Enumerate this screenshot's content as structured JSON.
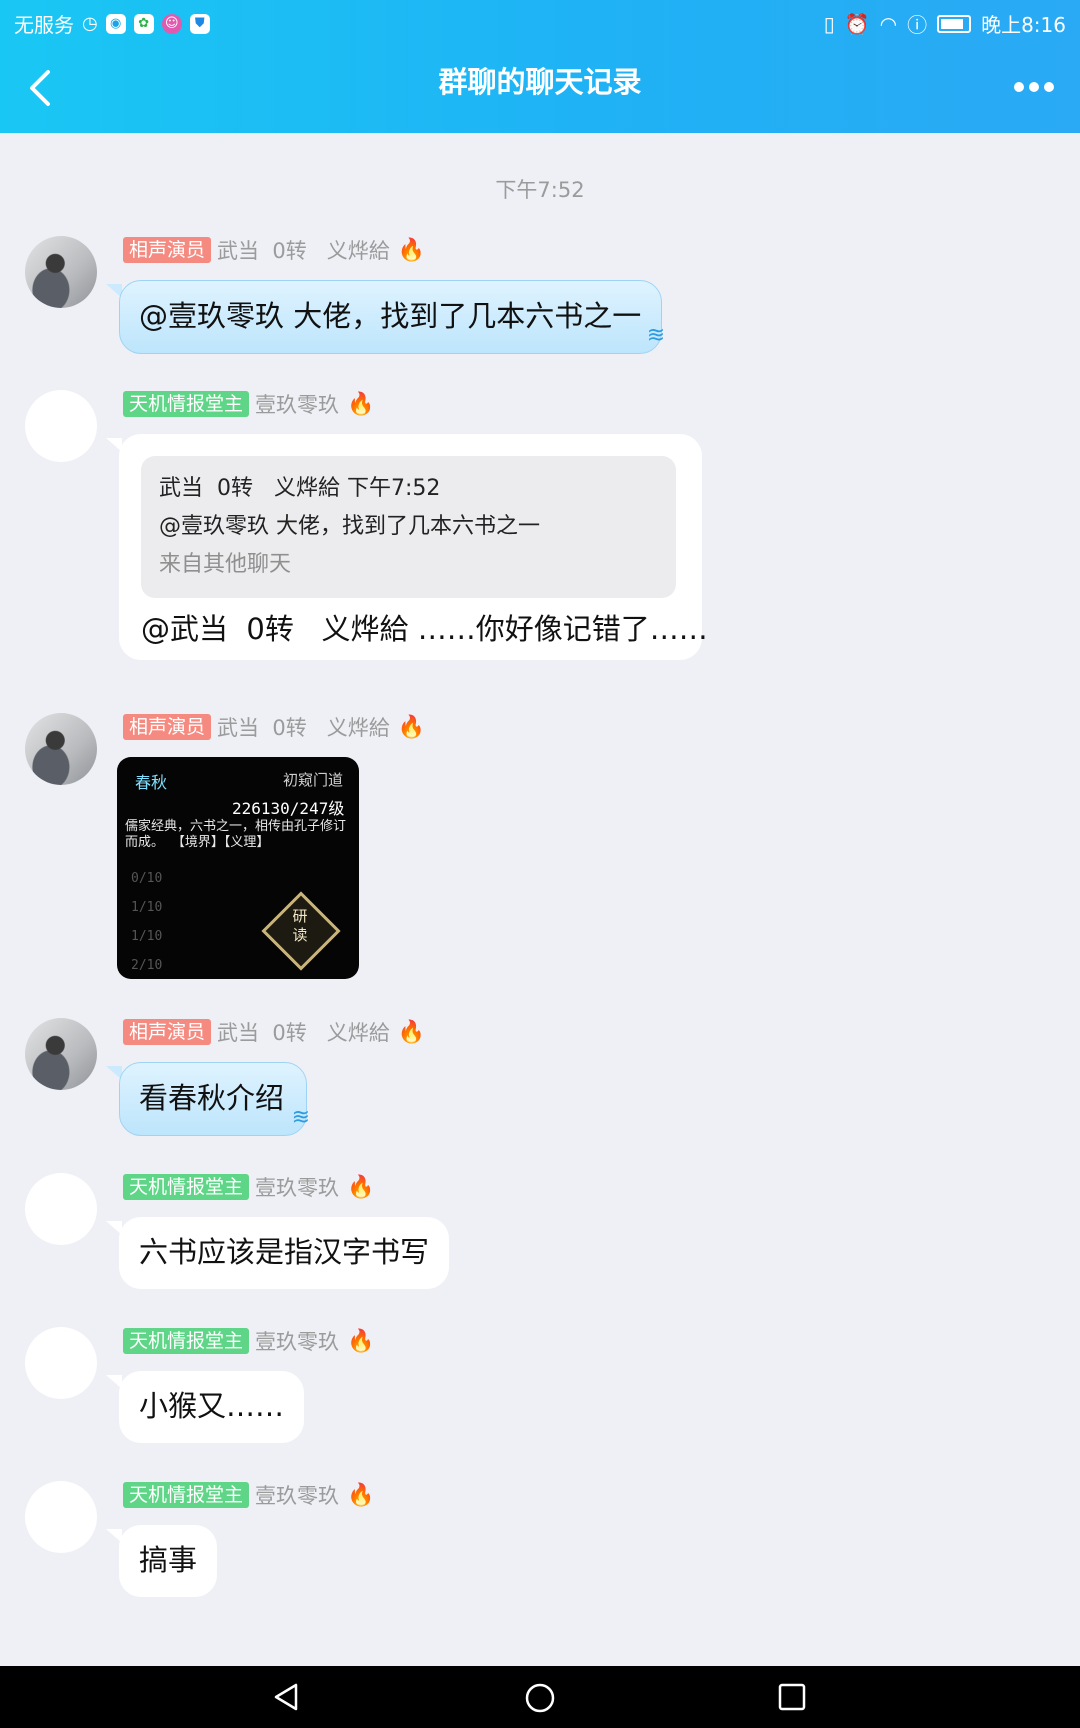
{
  "status_bar": {
    "carrier": "无服务",
    "time": "晚上8:16"
  },
  "header": {
    "title": "群聊的聊天记录"
  },
  "timestamp": "下午7:52",
  "messages": [
    {
      "badge": "相声演员",
      "sender": "武当  0转   义烨給",
      "text": "@壹玖零玖 大佬，找到了几本六书之一"
    },
    {
      "badge": "天机情报堂主",
      "sender": "壹玖零玖",
      "quote_header": "武当  0转   义烨給 下午7:52",
      "quote_text": "@壹玖零玖 大佬，找到了几本六书之一",
      "quote_source": "来自其他聊天",
      "text": "@武当  0转   义烨給 ……你好像记错了……"
    },
    {
      "badge": "相声演员",
      "sender": "武当  0转   义烨給",
      "image": {
        "tag": "春秋",
        "stage": "初窥门道",
        "progress": "226130/247级",
        "desc": "儒家经典，六书之一，相传由孔子修订而成。 【境界】【义理】",
        "rows": [
          "0/10",
          "1/10",
          "1/10",
          "2/10"
        ],
        "button_top": "研",
        "button_bottom": "读"
      }
    },
    {
      "badge": "相声演员",
      "sender": "武当  0转   义烨給",
      "text": "看春秋介绍"
    },
    {
      "badge": "天机情报堂主",
      "sender": "壹玖零玖",
      "text": "六书应该是指汉字书写"
    },
    {
      "badge": "天机情报堂主",
      "sender": "壹玖零玖",
      "text": "小猴又……"
    },
    {
      "badge": "天机情报堂主",
      "sender": "壹玖零玖",
      "text": "搞事"
    }
  ]
}
